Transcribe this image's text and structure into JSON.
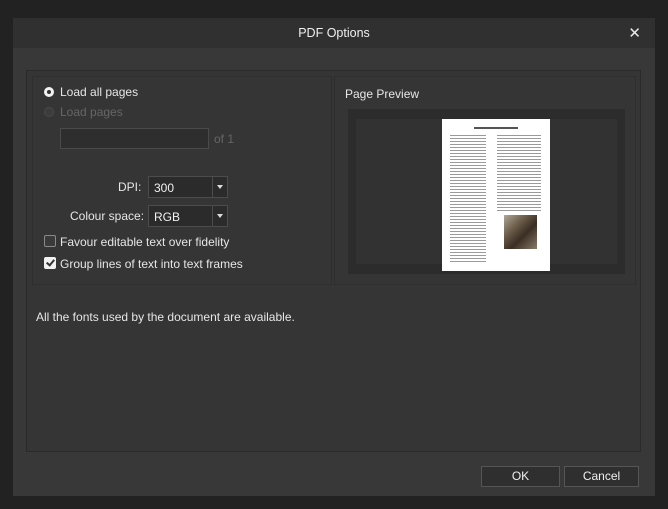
{
  "dialog": {
    "title": "PDF Options",
    "close_icon": "close-icon"
  },
  "load": {
    "all_pages_label": "Load all pages",
    "all_pages_selected": true,
    "load_pages_label": "Load pages",
    "pages_value": "",
    "of_label": "of 1"
  },
  "dpi": {
    "label": "DPI:",
    "value": "300"
  },
  "colour_space": {
    "label": "Colour space:",
    "value": "RGB"
  },
  "options": {
    "favour_editable_label": "Favour editable text over fidelity",
    "favour_editable_checked": false,
    "group_lines_label": "Group lines of text into text frames",
    "group_lines_checked": true
  },
  "preview": {
    "label": "Page Preview"
  },
  "status": {
    "fonts_message": "All the fonts used by the document are available."
  },
  "footer": {
    "ok_label": "OK",
    "cancel_label": "Cancel"
  }
}
